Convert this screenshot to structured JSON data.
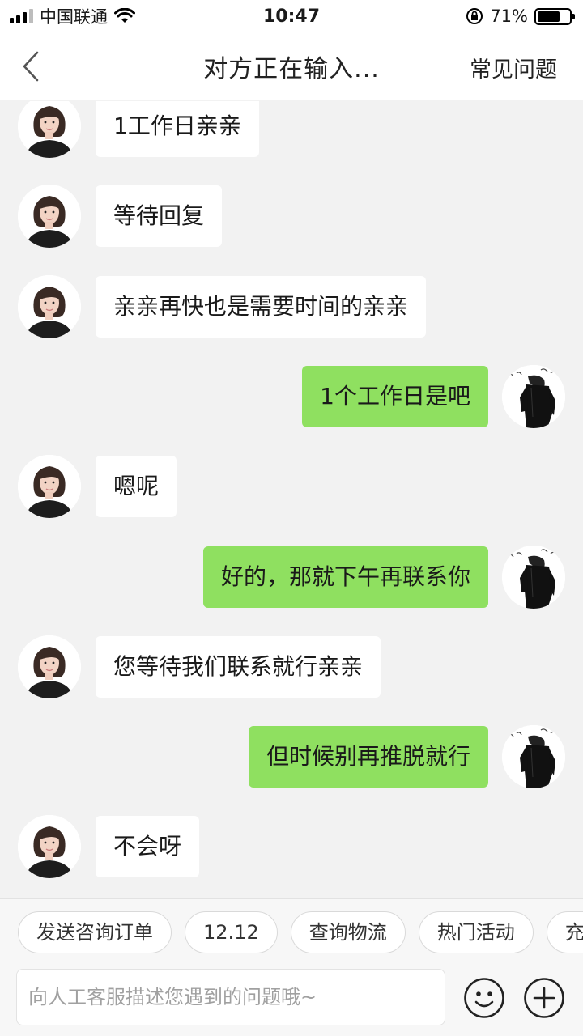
{
  "status_bar": {
    "carrier": "中国联通",
    "time": "10:47",
    "battery_text": "71%",
    "battery_level": 0.71
  },
  "nav": {
    "title": "对方正在输入...",
    "faq_label": "常见问题"
  },
  "messages": [
    {
      "side": "agent",
      "text": "1工作日亲亲"
    },
    {
      "side": "agent",
      "text": "等待回复"
    },
    {
      "side": "agent",
      "text": "亲亲再快也是需要时间的亲亲"
    },
    {
      "side": "user",
      "text": "1个工作日是吧"
    },
    {
      "side": "agent",
      "text": "嗯呢"
    },
    {
      "side": "user",
      "text": "好的，那就下午再联系你"
    },
    {
      "side": "agent",
      "text": "您等待我们联系就行亲亲"
    },
    {
      "side": "user",
      "text": "但时候别再推脱就行"
    },
    {
      "side": "agent",
      "text": "不会呀"
    }
  ],
  "quick_actions": [
    "发送咨询订单",
    "12.12",
    "查询物流",
    "热门活动",
    "充"
  ],
  "input": {
    "placeholder": "向人工客服描述您遇到的问题哦~"
  },
  "icons": {
    "back": "back-chevron-icon",
    "wifi": "wifi-icon",
    "lock": "rotation-lock-icon",
    "emoji": "emoji-icon",
    "plus": "plus-icon"
  },
  "colors": {
    "user_bubble": "#8fe060",
    "agent_bubble": "#ffffff",
    "background": "#f2f2f2"
  }
}
